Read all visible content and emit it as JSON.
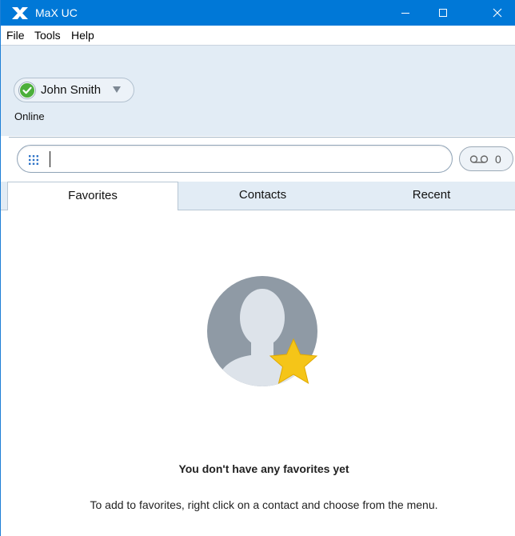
{
  "window": {
    "title": "MaX UC",
    "controls": {
      "minimize_icon": "minimize-icon",
      "maximize_icon": "maximize-icon",
      "close_icon": "close-icon"
    },
    "accent_color": "#0078d7"
  },
  "menu": {
    "items": [
      {
        "label": "File"
      },
      {
        "label": "Tools"
      },
      {
        "label": "Help"
      }
    ]
  },
  "user": {
    "name": "John Smith",
    "presence": "Online",
    "presence_color": "#4caf3b",
    "presence_icon": "check-circle-icon",
    "dropdown_icon": "caret-down-icon"
  },
  "search": {
    "value": "",
    "placeholder": "",
    "icon": "dialpad-icon"
  },
  "voicemail": {
    "icon": "voicemail-icon",
    "count": "0"
  },
  "tabs": [
    {
      "label": "Favorites",
      "active": true
    },
    {
      "label": "Contacts",
      "active": false
    },
    {
      "label": "Recent",
      "active": false
    }
  ],
  "empty_state": {
    "icon": "favorite-contact-icon",
    "title": "You don't have any favorites yet",
    "hint": "To add to favorites, right click on a contact and choose from the menu.",
    "star_color": "#f5c518"
  }
}
